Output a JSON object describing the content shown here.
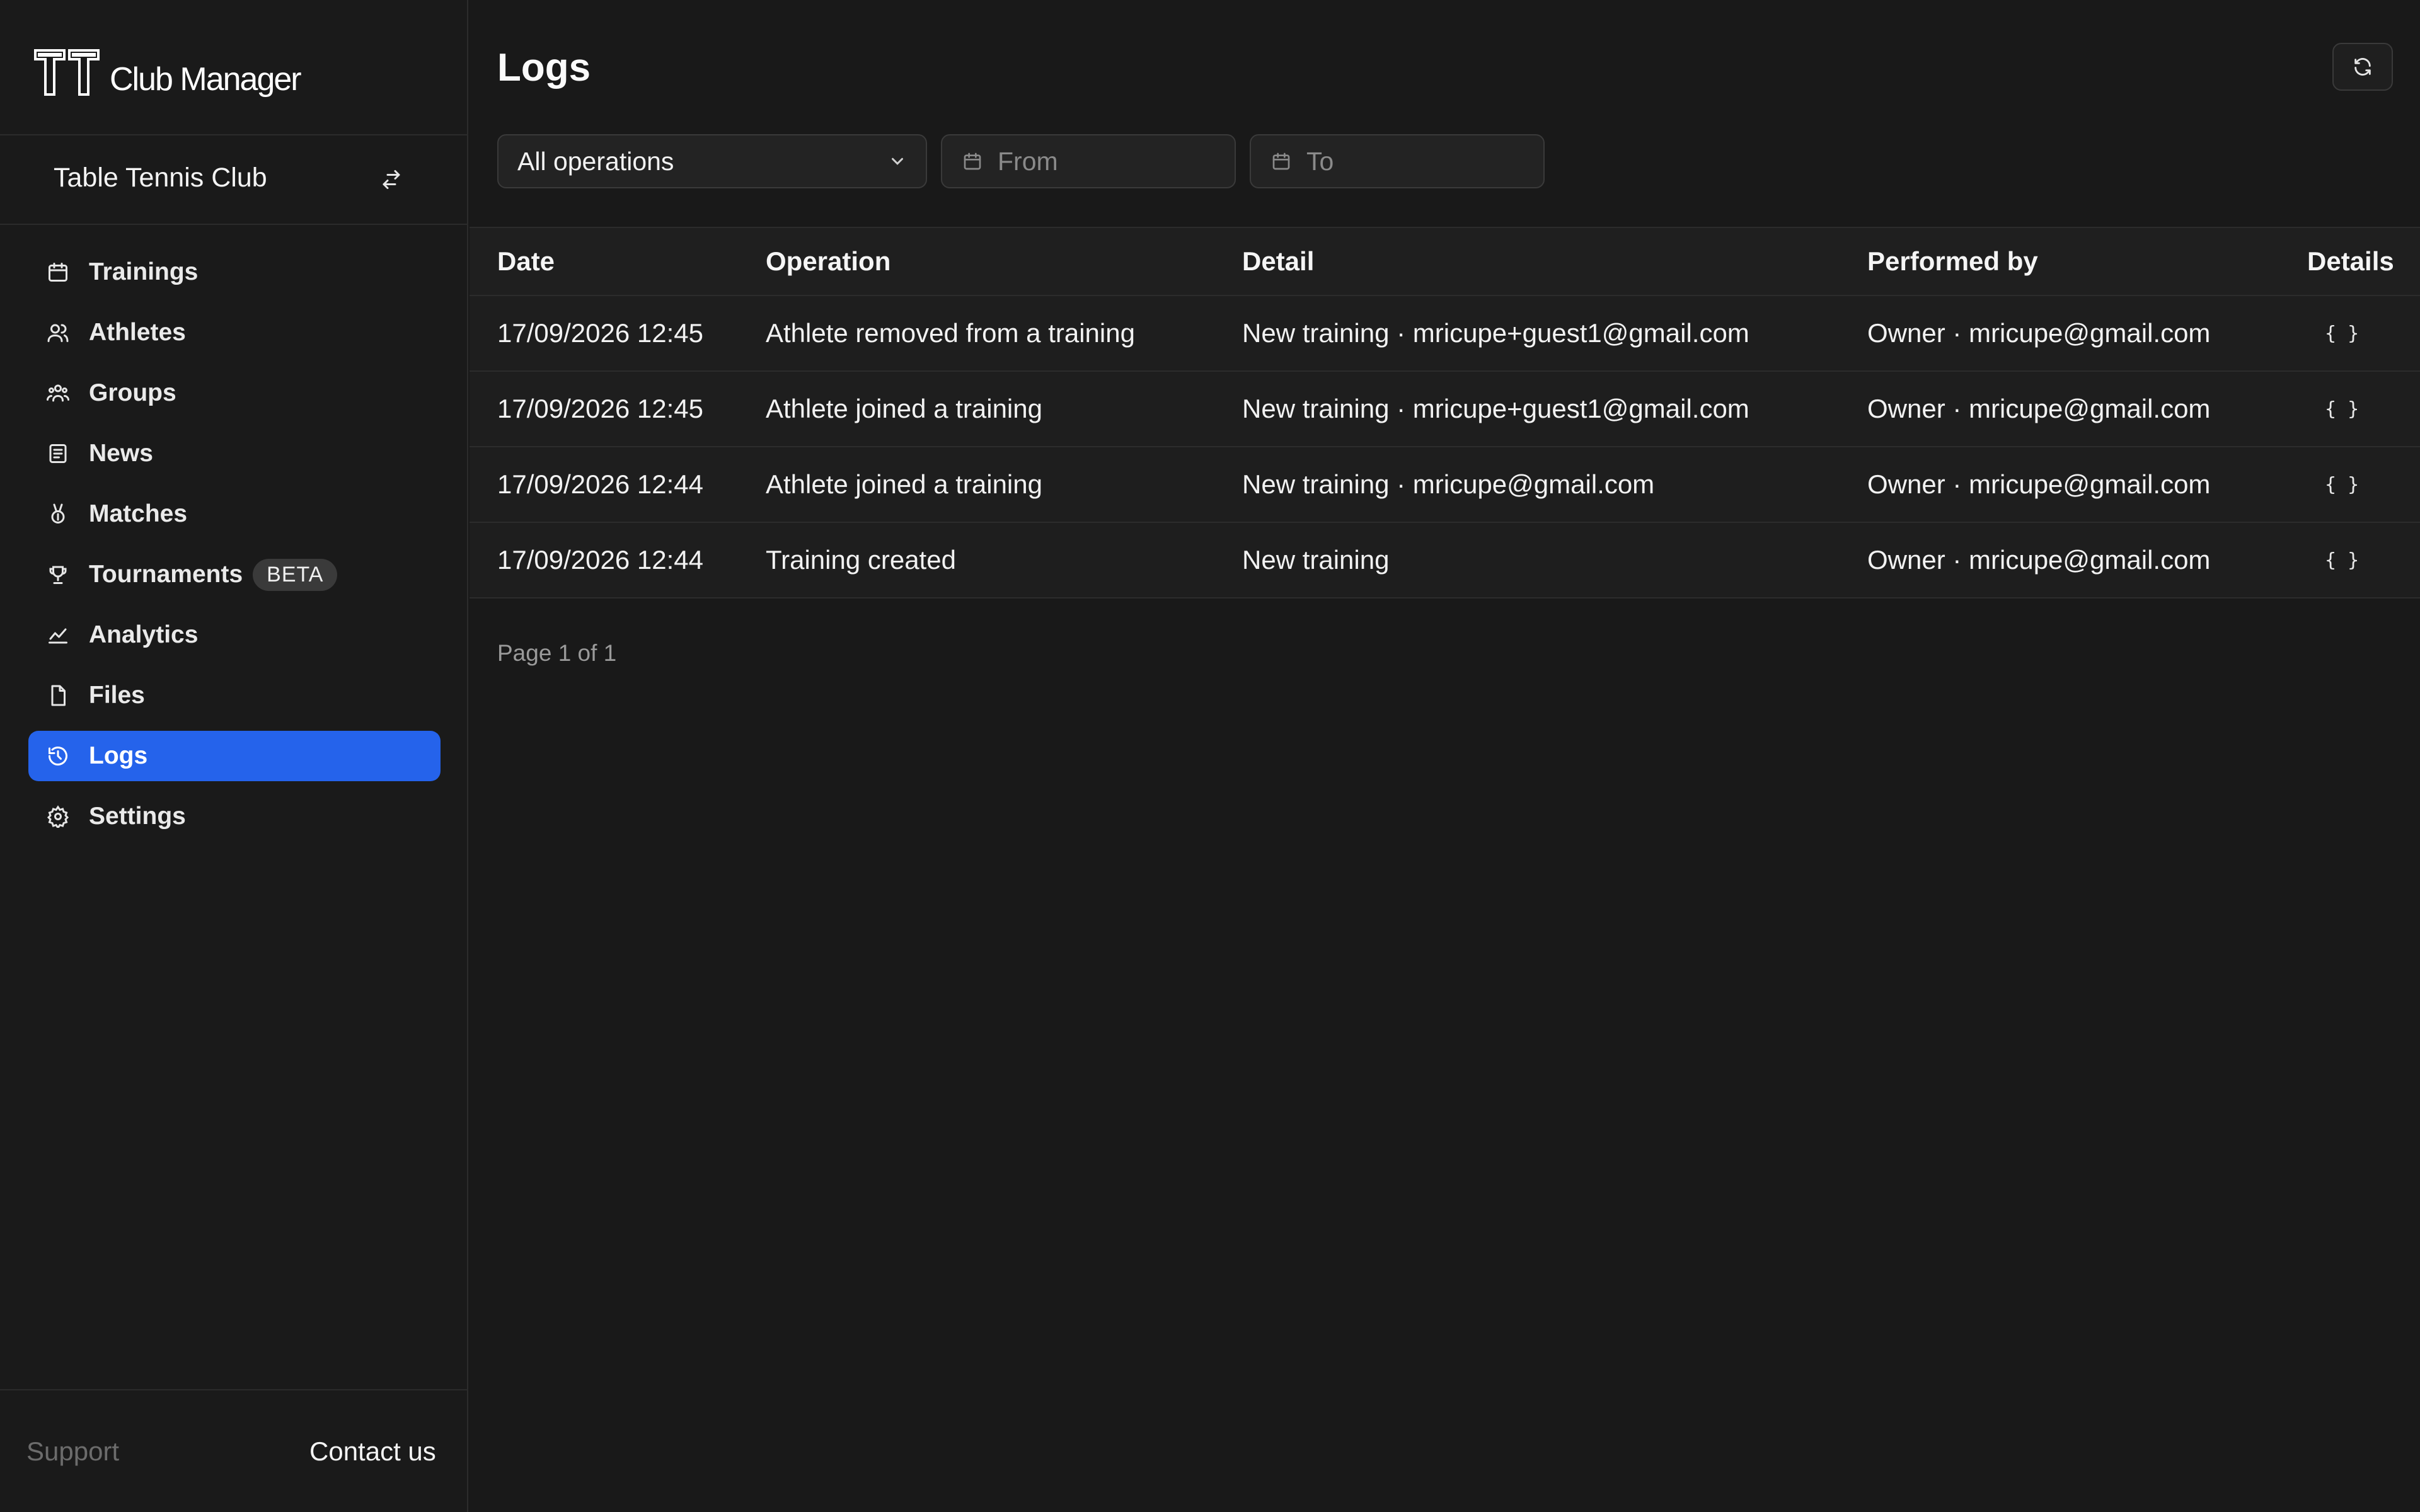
{
  "brand": {
    "name": "Club Manager",
    "logo_text": "TT"
  },
  "club": {
    "name": "Table Tennis Club"
  },
  "nav": {
    "items": [
      {
        "label": "Trainings",
        "icon": "calendar-icon"
      },
      {
        "label": "Athletes",
        "icon": "users-icon"
      },
      {
        "label": "Groups",
        "icon": "group-icon"
      },
      {
        "label": "News",
        "icon": "newspaper-icon"
      },
      {
        "label": "Matches",
        "icon": "medal-icon"
      },
      {
        "label": "Tournaments",
        "icon": "trophy-icon",
        "badge": "BETA"
      },
      {
        "label": "Analytics",
        "icon": "chart-icon"
      },
      {
        "label": "Files",
        "icon": "file-icon"
      },
      {
        "label": "Logs",
        "icon": "history-icon",
        "active": true
      },
      {
        "label": "Settings",
        "icon": "gear-icon"
      }
    ]
  },
  "footer": {
    "support": "Support",
    "contact": "Contact us"
  },
  "page": {
    "title": "Logs"
  },
  "filters": {
    "operation": "All operations",
    "from_placeholder": "From",
    "to_placeholder": "To"
  },
  "table": {
    "headers": {
      "date": "Date",
      "operation": "Operation",
      "detail": "Detail",
      "performed_by": "Performed by",
      "details": "Details"
    },
    "rows": [
      {
        "date": "17/09/2026 12:45",
        "operation": "Athlete removed from a training",
        "detail": "New training · mricupe+guest1@gmail.com",
        "performed_by": "Owner · mricupe@gmail.com",
        "details": "{ }"
      },
      {
        "date": "17/09/2026 12:45",
        "operation": "Athlete joined a training",
        "detail": "New training · mricupe+guest1@gmail.com",
        "performed_by": "Owner · mricupe@gmail.com",
        "details": "{ }"
      },
      {
        "date": "17/09/2026 12:44",
        "operation": "Athlete joined a training",
        "detail": "New training · mricupe@gmail.com",
        "performed_by": "Owner · mricupe@gmail.com",
        "details": "{ }"
      },
      {
        "date": "17/09/2026 12:44",
        "operation": "Training created",
        "detail": "New training",
        "performed_by": "Owner · mricupe@gmail.com",
        "details": "{ }"
      }
    ]
  },
  "pagination": {
    "text": "Page 1 of 1"
  },
  "colors": {
    "accent": "#2563eb",
    "background": "#191919",
    "border": "#2c2c2c"
  }
}
